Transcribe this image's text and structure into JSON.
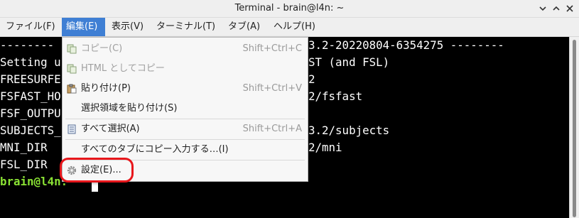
{
  "window": {
    "title": "Terminal - brain@l4n: ~"
  },
  "menubar": {
    "items": [
      {
        "label": "ファイル(F)"
      },
      {
        "label": "編集(E)"
      },
      {
        "label": "表示(V)"
      },
      {
        "label": "ターミナル(T)"
      },
      {
        "label": "タブ(A)"
      },
      {
        "label": "ヘルプ(H)"
      }
    ]
  },
  "edit_menu": {
    "items": [
      {
        "label": "コピー(C)",
        "shortcut": "Shift+Ctrl+C",
        "icon": "copy-icon",
        "enabled": false
      },
      {
        "label": "HTML としてコピー",
        "shortcut": "",
        "icon": "copy-html-icon",
        "enabled": false
      },
      {
        "label": "貼り付け(P)",
        "shortcut": "Shift+Ctrl+V",
        "icon": "paste-icon",
        "enabled": true
      },
      {
        "label": "選択領域を貼り付け(S)",
        "shortcut": "",
        "icon": "",
        "enabled": true
      },
      {
        "label": "すべて選択(A)",
        "shortcut": "Shift+Ctrl+A",
        "icon": "select-all-icon",
        "enabled": true
      },
      {
        "label": "すべてのタブにコピー入力する…(I)",
        "shortcut": "",
        "icon": "",
        "enabled": true
      },
      {
        "label": "設定(E)...",
        "shortcut": "",
        "icon": "gear-icon",
        "enabled": true
      }
    ]
  },
  "terminal": {
    "lines_left": [
      "--------",
      "Setting u",
      "FREESURFE",
      "FSFAST_HO",
      "FSF_OUTPU",
      "SUBJECTS_",
      "MNI_DIR",
      "FSL_DIR"
    ],
    "lines_right": [
      "3.2-20220804-6354275 --------",
      "ST (and FSL)",
      "2",
      "2/fsfast",
      "",
      "3.2/subjects",
      "2/mni",
      ""
    ],
    "prompt": "brain@l4n:"
  },
  "colors": {
    "menu_active": "#3f7fd4",
    "prompt": "#8ae234",
    "highlight_ring": "#e8171c"
  }
}
